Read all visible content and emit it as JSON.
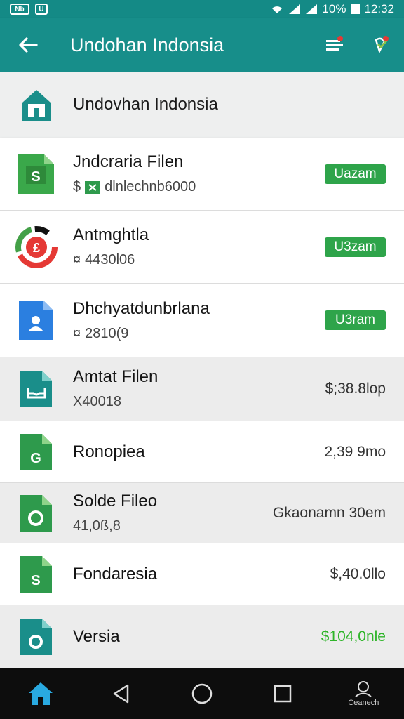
{
  "status_bar": {
    "notif_1": "Nb",
    "notif_2": "U",
    "battery": "10%",
    "time": "12:32"
  },
  "app_bar": {
    "title": "Undohan Indonsia",
    "back_icon": "arrow-left-icon",
    "filter_icon": "filter-list-icon",
    "account_icon": "heart-check-icon"
  },
  "header": {
    "title": "Undovhan Indonsia",
    "icon": "home-icon"
  },
  "highlighted_items": [
    {
      "title": "Jndcraria Filen",
      "subtitle_prefix": "$",
      "subtitle": "dlnlechnb6000",
      "badge": "Uazam",
      "icon": "spreadsheet-file-icon"
    },
    {
      "title": "Antmghtla",
      "subtitle_prefix": "¤",
      "subtitle": "4430l06",
      "badge": "U3zam",
      "icon": "pound-pie-icon"
    },
    {
      "title": "Dhchyatdunbrlana",
      "subtitle_prefix": "¤",
      "subtitle": "2810(9",
      "badge": "U3ram",
      "icon": "user-document-icon"
    }
  ],
  "list_items": [
    {
      "title": "Amtat Filen",
      "subtitle": "X40018",
      "value": "$;38.8lop",
      "icon": "inbox-file-icon"
    },
    {
      "title": "Ronopiea",
      "subtitle": "",
      "value": "2,39 9mo",
      "icon": "g-file-icon"
    },
    {
      "title": "Solde Fileo",
      "subtitle": "41,0ß,8",
      "value": "Gkaonamn 30em",
      "icon": "c-file-icon"
    },
    {
      "title": "Fondaresia",
      "subtitle": "",
      "value": "$,40.0llo",
      "icon": "s-file-icon"
    },
    {
      "title": "Versia",
      "subtitle": "",
      "value": "$104,0nle",
      "icon": "o-file-icon"
    }
  ],
  "nav_bar": {
    "home_icon": "home-icon",
    "back_icon": "triangle-back-icon",
    "home_circle_icon": "circle-home-icon",
    "recents_icon": "square-recents-icon",
    "account_icon": "person-icon",
    "account_label": "Ceanech"
  },
  "colors": {
    "primary": "#178e8a",
    "badge_green": "#2ea44a",
    "file_green": "#2e9a4c",
    "file_teal": "#1a8e8a",
    "file_blue": "#2b7fe0",
    "value_green": "#2fb52a"
  }
}
